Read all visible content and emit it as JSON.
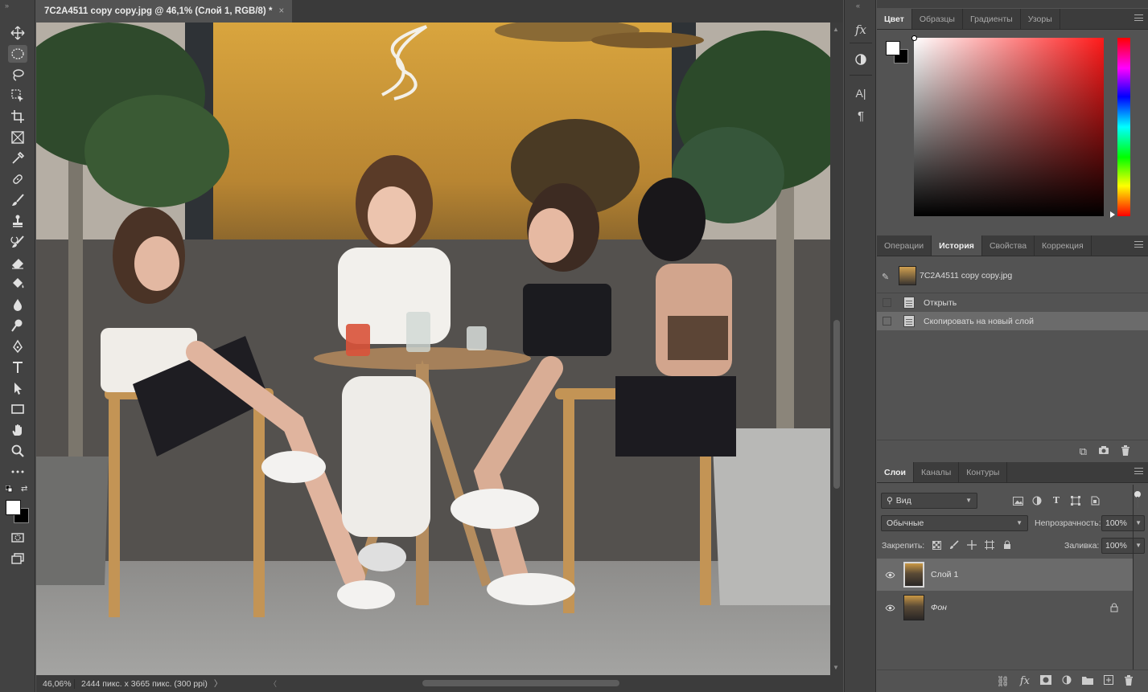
{
  "document": {
    "tab_title": "7C2A4511 copy copy.jpg @ 46,1% (Слой 1, RGB/8) *",
    "close_glyph": "×"
  },
  "status_bar": {
    "zoom": "46,06%",
    "doc_info": "2444 пикс. x 3665 пикс. (300 ppi)",
    "more_glyph": "〉"
  },
  "toolbar": {
    "tools": [
      {
        "name": "move-tool",
        "icon": "move-icon"
      },
      {
        "name": "elliptical-marquee-tool",
        "icon": "ellipse-marquee-icon",
        "active": true
      },
      {
        "name": "lasso-tool",
        "icon": "lasso-icon"
      },
      {
        "name": "object-selection-tool",
        "icon": "object-selection-icon"
      },
      {
        "name": "crop-tool",
        "icon": "crop-icon"
      },
      {
        "name": "frame-tool",
        "icon": "frame-icon"
      },
      {
        "name": "eyedropper-tool",
        "icon": "eyedropper-icon"
      },
      {
        "name": "healing-brush-tool",
        "icon": "bandage-icon"
      },
      {
        "name": "brush-tool",
        "icon": "brush-icon"
      },
      {
        "name": "clone-stamp-tool",
        "icon": "stamp-icon"
      },
      {
        "name": "history-brush-tool",
        "icon": "history-brush-icon"
      },
      {
        "name": "eraser-tool",
        "icon": "eraser-icon"
      },
      {
        "name": "paint-bucket-tool",
        "icon": "bucket-icon"
      },
      {
        "name": "blur-tool",
        "icon": "drop-icon"
      },
      {
        "name": "dodge-tool",
        "icon": "dodge-icon"
      },
      {
        "name": "pen-tool",
        "icon": "pen-icon"
      },
      {
        "name": "type-tool",
        "icon": "type-icon"
      },
      {
        "name": "path-selection-tool",
        "icon": "arrow-icon"
      },
      {
        "name": "rectangle-tool",
        "icon": "rectangle-icon"
      },
      {
        "name": "hand-tool",
        "icon": "hand-icon"
      },
      {
        "name": "zoom-tool",
        "icon": "magnifier-icon"
      },
      {
        "name": "edit-toolbar",
        "icon": "more-icon"
      }
    ],
    "foreground_color": "#ffffff",
    "background_color": "#000000"
  },
  "color_panel": {
    "tabs": [
      "Цвет",
      "Образцы",
      "Градиенты",
      "Узоры"
    ],
    "active_tab": "Цвет",
    "hue_color": "#ff1a1a"
  },
  "history_panel": {
    "tabs": [
      "Операции",
      "История",
      "Свойства",
      "Коррекция"
    ],
    "active_tab": "История",
    "snapshot_label": "7C2A4511 copy copy.jpg",
    "states": [
      {
        "label": "Открыть"
      },
      {
        "label": "Скопировать на новый слой",
        "selected": true
      }
    ]
  },
  "layers_panel": {
    "tabs": [
      "Слои",
      "Каналы",
      "Контуры"
    ],
    "active_tab": "Слои",
    "filter_value": "Вид",
    "blend_mode": "Обычные",
    "opacity_label": "Непрозрачность:",
    "opacity_value": "100%",
    "lock_label": "Закрепить:",
    "fill_label": "Заливка:",
    "fill_value": "100%",
    "layers": [
      {
        "name": "Слой 1",
        "selected": true,
        "visible": true,
        "locked": false
      },
      {
        "name": "Фон",
        "selected": false,
        "visible": true,
        "locked": true
      }
    ]
  },
  "icon_column": {
    "fx_label": "fx",
    "type_label": "A|",
    "pilcrow": "¶"
  }
}
